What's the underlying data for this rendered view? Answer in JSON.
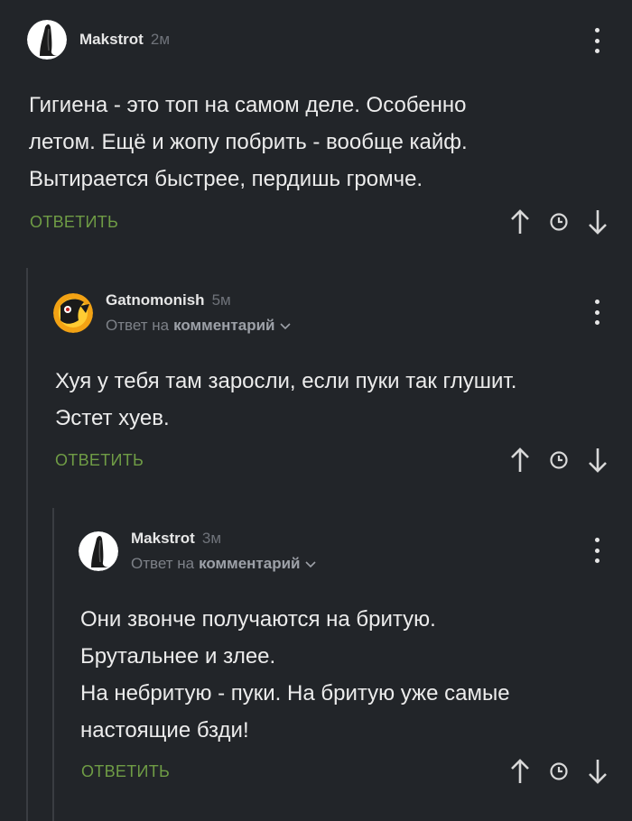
{
  "comments": [
    {
      "author": "Makstrot",
      "time": "2м",
      "text_lines": [
        "Гигиена - это топ на самом деле. Особенно",
        "летом. Ещё и жопу побрить - вообще кайф.",
        "Вытирается быстрее, пердишь громче."
      ],
      "reply_label": "ОТВЕТИТЬ"
    },
    {
      "author": "Gatnomonish",
      "time": "5м",
      "reply_to_prefix": "Ответ на",
      "reply_to_link": "комментарий",
      "text_lines": [
        "Хуя у тебя там заросли, если пуки так глушит.",
        "Эстет хуев."
      ],
      "reply_label": "ОТВЕТИТЬ"
    },
    {
      "author": "Makstrot",
      "time": "3м",
      "reply_to_prefix": "Ответ на",
      "reply_to_link": "комментарий",
      "text_lines": [
        "Они звонче получаются на бритую.",
        "Брутальнее и злее.",
        "На небритую - пуки. На бритую уже самые",
        "настоящие бзди!"
      ],
      "reply_label": "ОТВЕТИТЬ"
    }
  ],
  "colors": {
    "background": "#222529",
    "reply_green": "#6f9c45",
    "muted": "#6f737a",
    "thread_line": "#3a3d42"
  },
  "icons": [
    "up-arrow-icon",
    "clock-icon",
    "down-arrow-icon",
    "more-vertical-icon",
    "chevron-down-icon"
  ]
}
